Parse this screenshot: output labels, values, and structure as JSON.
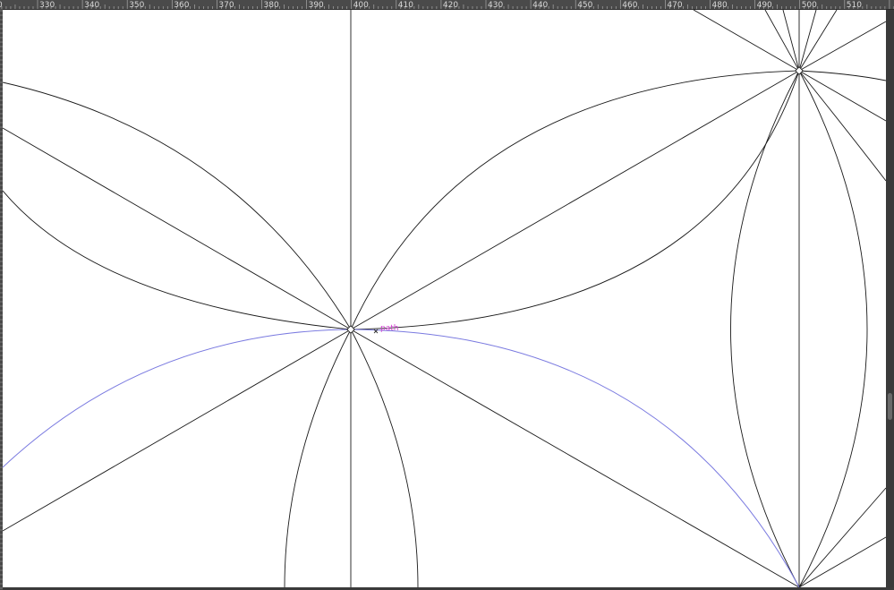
{
  "ruler": {
    "units": "px",
    "ticks": [
      "330",
      "340",
      "350",
      "360",
      "370",
      "380",
      "390",
      "400",
      "410",
      "420",
      "430",
      "440",
      "450",
      "460",
      "470",
      "480",
      "490",
      "500",
      "510"
    ],
    "partial_left_tick": "0"
  },
  "canvas": {
    "snap_label": "path",
    "background": "#ffffff",
    "line_color": "#1a1a1a",
    "highlight_color": "#7a7ae0",
    "label_color": "#d040d0"
  },
  "icons": {
    "snap_cursor": "cross-icon",
    "node": "node-icon"
  }
}
